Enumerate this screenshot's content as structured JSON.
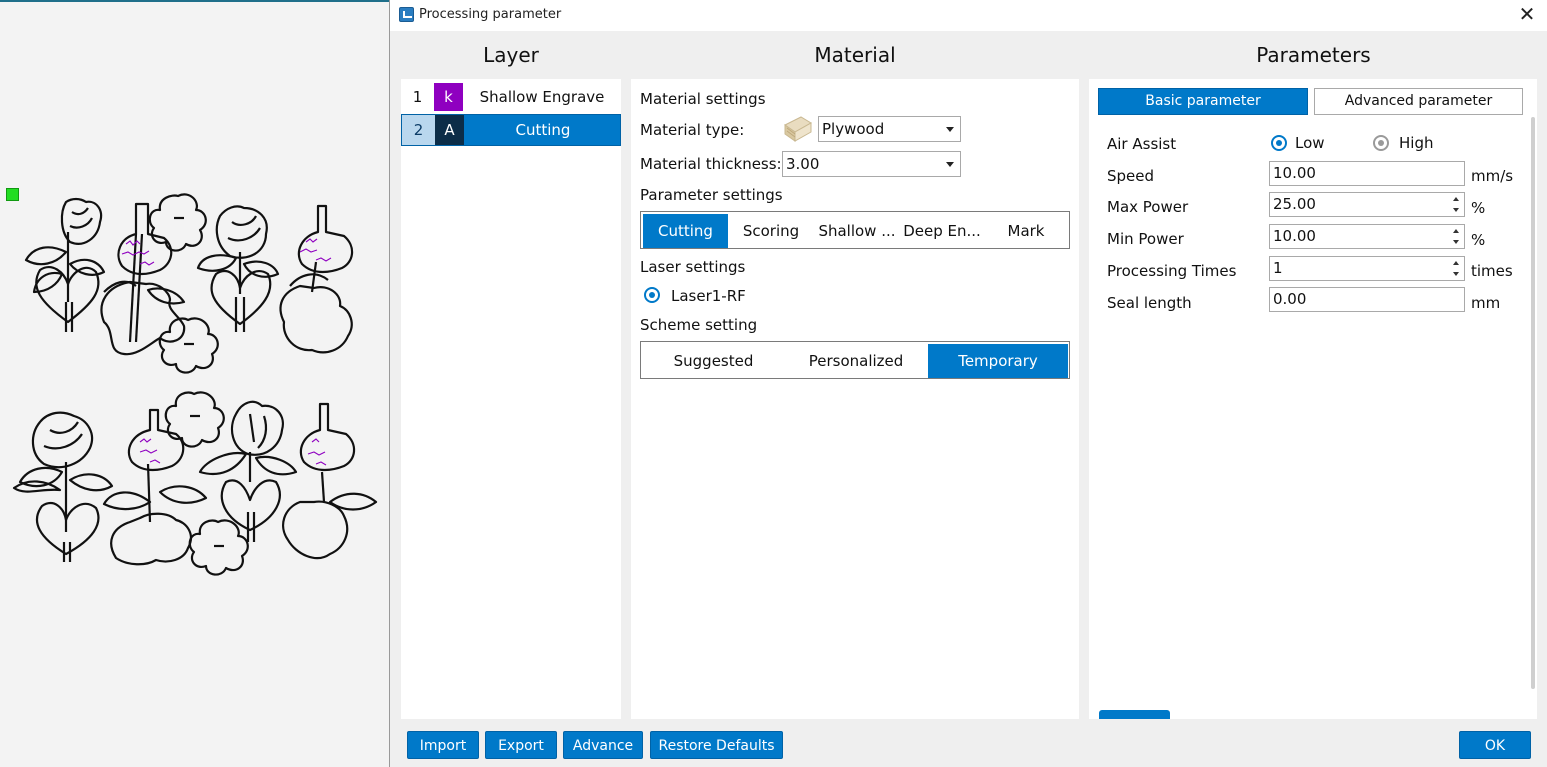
{
  "window": {
    "title": "Processing parameter",
    "close_glyph": "✕"
  },
  "headers": {
    "layer": "Layer",
    "material": "Material",
    "parameters": "Parameters"
  },
  "layers": [
    {
      "num": "1",
      "tag": "k",
      "name": "Shallow Engrave",
      "color": "#8f00c0",
      "selected": false
    },
    {
      "num": "2",
      "tag": "A",
      "name": "Cutting",
      "color": "#0c2d48",
      "selected": true
    }
  ],
  "material": {
    "settings_title": "Material settings",
    "type_label": "Material type:",
    "type_value": "Plywood",
    "thickness_label": "Material thickness:",
    "thickness_value": "3.00",
    "param_settings_title": "Parameter settings",
    "param_tabs": [
      "Cutting",
      "Scoring",
      "Shallow ...",
      "Deep En...",
      "Mark"
    ],
    "param_tab_active": "Cutting",
    "laser_title": "Laser settings",
    "laser_option": "Laser1-RF",
    "scheme_title": "Scheme setting",
    "scheme_tabs": [
      "Suggested",
      "Personalized",
      "Temporary"
    ],
    "scheme_tab_active": "Temporary"
  },
  "params": {
    "tab_basic": "Basic parameter",
    "tab_advanced": "Advanced parameter",
    "air_assist_label": "Air Assist",
    "air_low": "Low",
    "air_high": "High",
    "air_selected": "Low",
    "speed_label": "Speed",
    "speed_value": "10.00",
    "speed_unit": "mm/s",
    "max_power_label": "Max Power",
    "max_power_value": "25.00",
    "max_power_unit": "%",
    "min_power_label": "Min Power",
    "min_power_value": "10.00",
    "min_power_unit": "%",
    "times_label": "Processing Times",
    "times_value": "1",
    "times_unit": "times",
    "seal_label": "Seal length",
    "seal_value": "0.00",
    "seal_unit": "mm"
  },
  "buttons": {
    "import": "Import",
    "export": "Export",
    "advance": "Advance",
    "restore": "Restore Defaults",
    "ok": "OK"
  },
  "colors": {
    "accent": "#0079c9",
    "layer_k": "#8f00c0",
    "canvas_handle": "#22dd22",
    "engrave_text": "#8f00c0"
  }
}
